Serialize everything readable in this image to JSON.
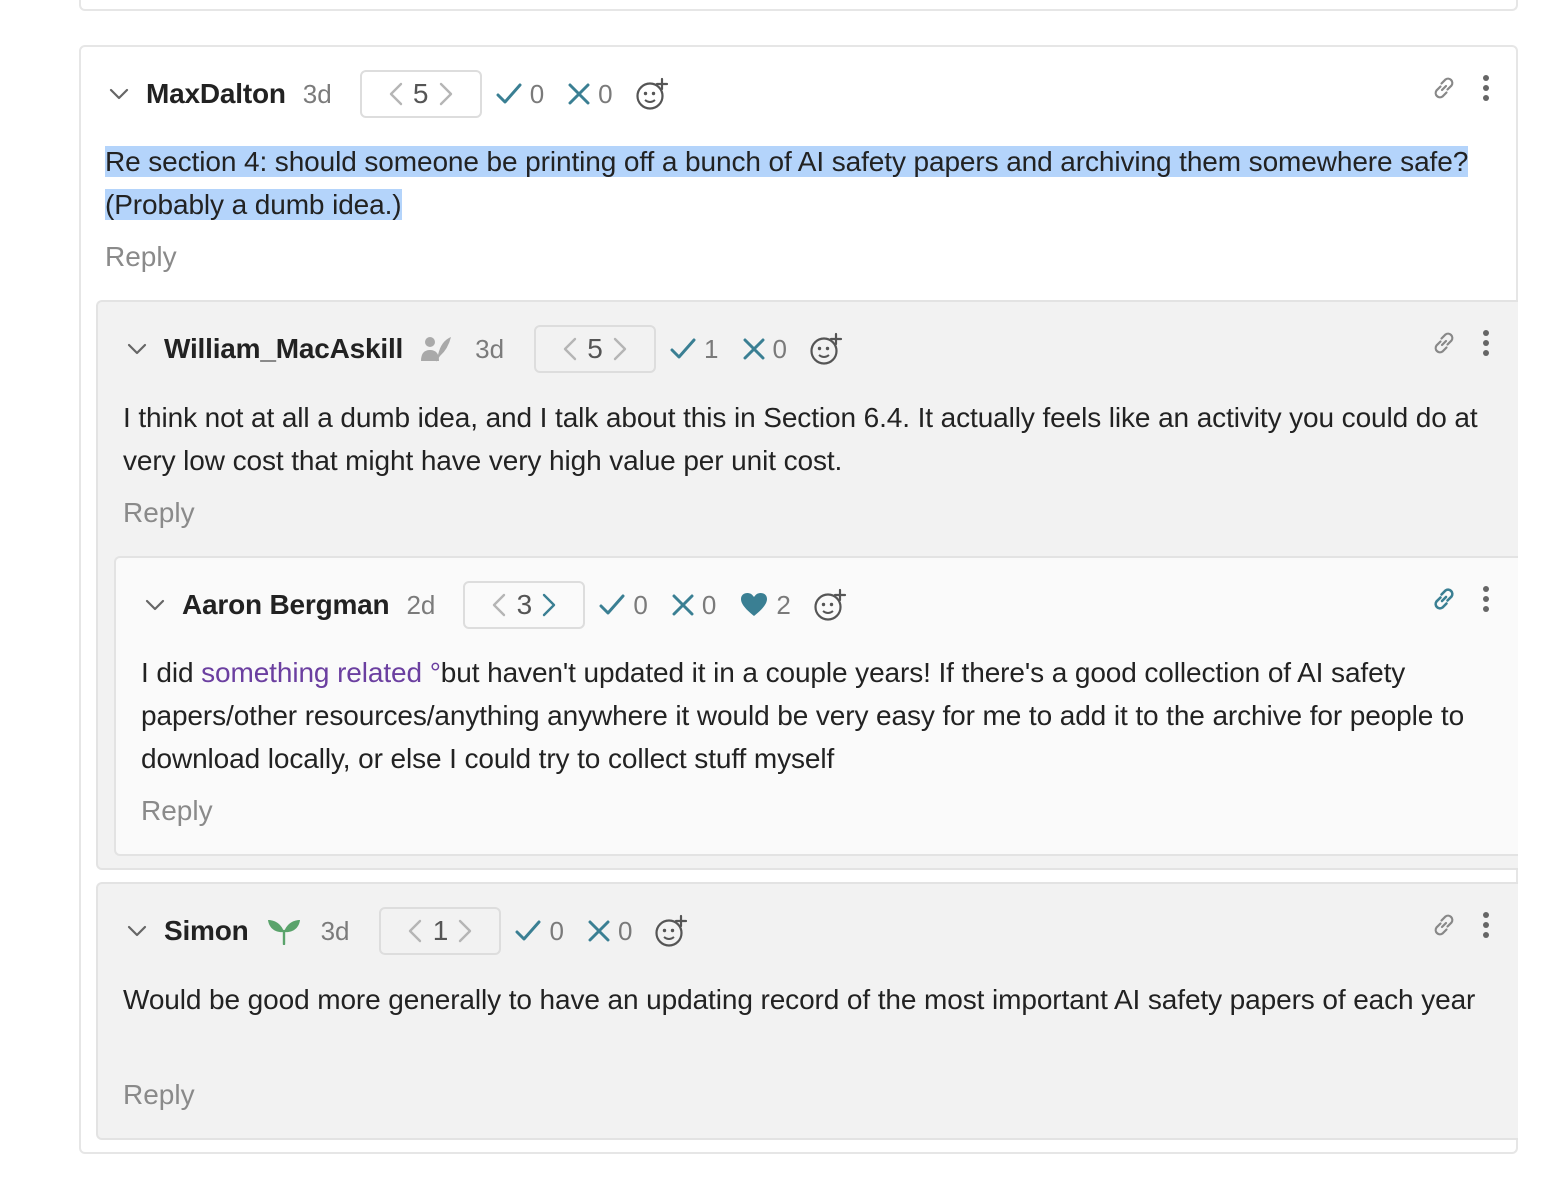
{
  "comments": [
    {
      "author": "MaxDalton",
      "age": "3d",
      "karma": "5",
      "agree": "0",
      "disagree": "0",
      "body": "Re section 4: should someone be printing off a bunch of AI safety papers and archiving them somewhere safe? (Probably a dumb idea.)",
      "reply_label": "Reply"
    },
    {
      "author": "William_MacAskill",
      "age": "3d",
      "karma": "5",
      "agree": "1",
      "disagree": "0",
      "body": "I think not at all a dumb idea, and I talk about this in Section 6.4. It actually feels like an activity you could do at very low cost that might have very high value per unit cost.",
      "reply_label": "Reply"
    },
    {
      "author": "Aaron Bergman",
      "age": "2d",
      "karma": "3",
      "agree": "0",
      "disagree": "0",
      "heart": "2",
      "body_prefix": "I did ",
      "link_text": "something related",
      "link_marker": "°",
      "body_suffix": "but haven't updated it in a couple years! If there's a good collection of AI safety papers/other resources/anything anywhere it would be very easy for me to add it to the archive for people to download locally, or else I could try to collect stuff myself",
      "reply_label": "Reply"
    },
    {
      "author": "Simon",
      "age": "3d",
      "karma": "1",
      "agree": "0",
      "disagree": "0",
      "body": "Would be good more generally to have an updating record of the most important AI safety papers of each year",
      "reply_label": "Reply"
    }
  ],
  "colors": {
    "accent": "#3a7f93",
    "link": "#6b3fa0",
    "highlight": "#b4d4fb",
    "muted": "#8a8a8a"
  },
  "icons": [
    "chevron-down-icon",
    "chevron-left-icon",
    "chevron-right-icon",
    "check-icon",
    "cross-icon",
    "heart-icon",
    "add-reaction-icon",
    "link-icon",
    "more-options-icon",
    "author-badge-icon",
    "new-user-sprout-icon"
  ]
}
